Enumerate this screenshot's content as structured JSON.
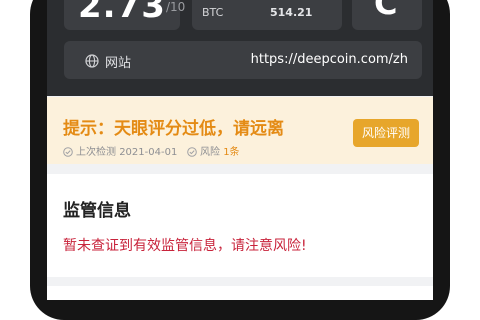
{
  "header": {
    "score": "2.73",
    "score_max": "/10",
    "currency": "BTC",
    "currency_value": "514.21",
    "rating": "C",
    "website_label": "网站",
    "website_url": "https://deepcoin.com/zh"
  },
  "warning": {
    "title": "提示：天眼评分过低，请远离",
    "risk_button": "风险评测",
    "last_check_label": "上次检测",
    "last_check_date": "2021-04-01",
    "risk_label": "风险",
    "risk_count": "1条"
  },
  "regulation": {
    "title": "监管信息",
    "message": "暂未查证到有效监管信息，请注意风险!"
  },
  "colors": {
    "accent_orange": "#e48b15",
    "warning_bg": "#fcf1dc",
    "alert_red": "#c8233b",
    "button_gold": "#e7a62b"
  },
  "icons": [
    "globe-icon",
    "check-circle-icon"
  ]
}
